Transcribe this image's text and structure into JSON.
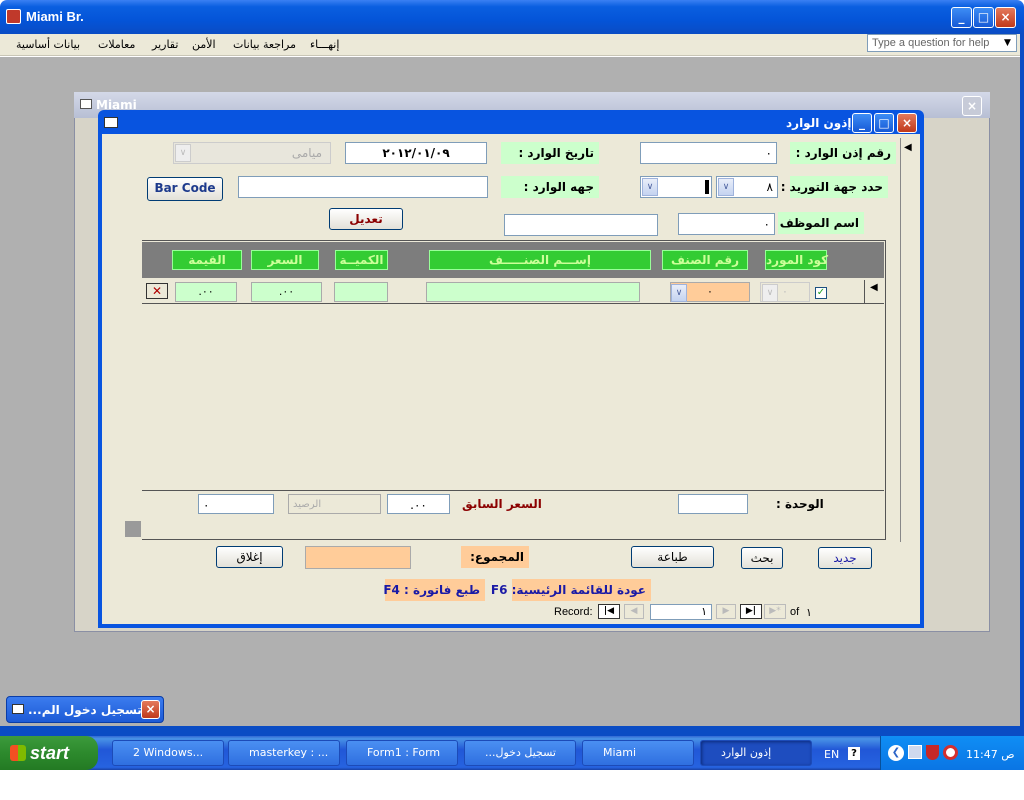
{
  "app": {
    "title": "Miami Br.",
    "minimize": "_",
    "maximize": "□",
    "close": "×",
    "help_placeholder": "Type a question for help",
    "menu": [
      "إنهـــاء",
      "مراجعة بيانات",
      "الأمن",
      "تقارير",
      "معاملات",
      "بيانات أساسية"
    ]
  },
  "bg_window": {
    "title": "Miami"
  },
  "form": {
    "title": "إذون الوارد",
    "labels": {
      "receipt_no": "رقم إذن الوارد :",
      "receipt_date": "تاريخ الوارد :",
      "supplier_select": "حدد جهة التوريد :",
      "source": "جهه الوارد :",
      "employee": "اسم الموظف :"
    },
    "values": {
      "receipt_no": "٠",
      "receipt_date": "٢٠١٢/٠١/٠٩",
      "branch": "ميامى",
      "supplier_code": "٨",
      "employee_code": "٠"
    },
    "buttons": {
      "barcode": "Bar Code",
      "edit": "تعديل"
    }
  },
  "subform": {
    "columns": [
      "كود المورد",
      "رقم الصنف",
      "إســـم الصنـــــف",
      "الكميــة",
      "السعر",
      "القيمة"
    ],
    "row": {
      "supplier_code": "٠",
      "item_no": "٠",
      "price": ".٠٠",
      "value": ".٠٠"
    },
    "footer": {
      "unit_label": "الوحدة :",
      "prev_price_label": "السعر السابق",
      "prev_price": ".٠٠",
      "balance_placeholder": "الرصيد",
      "last_value": "٠"
    }
  },
  "form_footer": {
    "buttons": {
      "new": "جديد",
      "search": "بحث",
      "print": "طباعة",
      "close": "إغلاق"
    },
    "total_label": "المجموع:",
    "hint_main_menu": "عودة للقائمة الرئيسية: F6",
    "hint_print_invoice": "طبع فاتورة : F4",
    "record_label": "Record:",
    "record_current": "١",
    "record_of": "of",
    "record_total": "١"
  },
  "minimized_window": {
    "title": "...تسجيل دخول الم"
  },
  "taskbar": {
    "start": "start",
    "items": [
      "2 Windows...",
      "masterkey : ...",
      "Form1 : Form",
      "...تسجيل دخول",
      "Miami",
      "إذون الوارد"
    ],
    "lang": "EN",
    "clock": "11:47 ص"
  }
}
